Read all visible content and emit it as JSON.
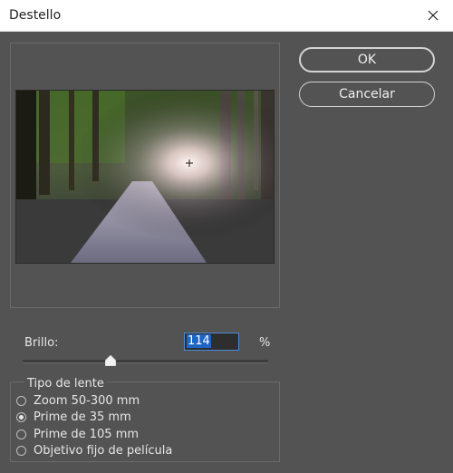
{
  "window": {
    "title": "Destello"
  },
  "buttons": {
    "ok": "OK",
    "cancel": "Cancelar"
  },
  "brightness": {
    "label": "Brillo:",
    "value": "114",
    "unit": "%",
    "slider_fraction": 0.36
  },
  "lens": {
    "group_title": "Tipo de lente",
    "options": [
      {
        "label": "Zoom 50-300 mm",
        "checked": false
      },
      {
        "label": "Prime de 35 mm",
        "checked": true
      },
      {
        "label": "Prime de 105 mm",
        "checked": false
      },
      {
        "label": "Objetivo fijo de película",
        "checked": false
      }
    ]
  },
  "icons": {
    "close": "close-icon",
    "flare_center": "crosshair-icon"
  },
  "colors": {
    "background": "#535353",
    "titlebar": "#ffffff",
    "selection": "#1f66c4"
  }
}
